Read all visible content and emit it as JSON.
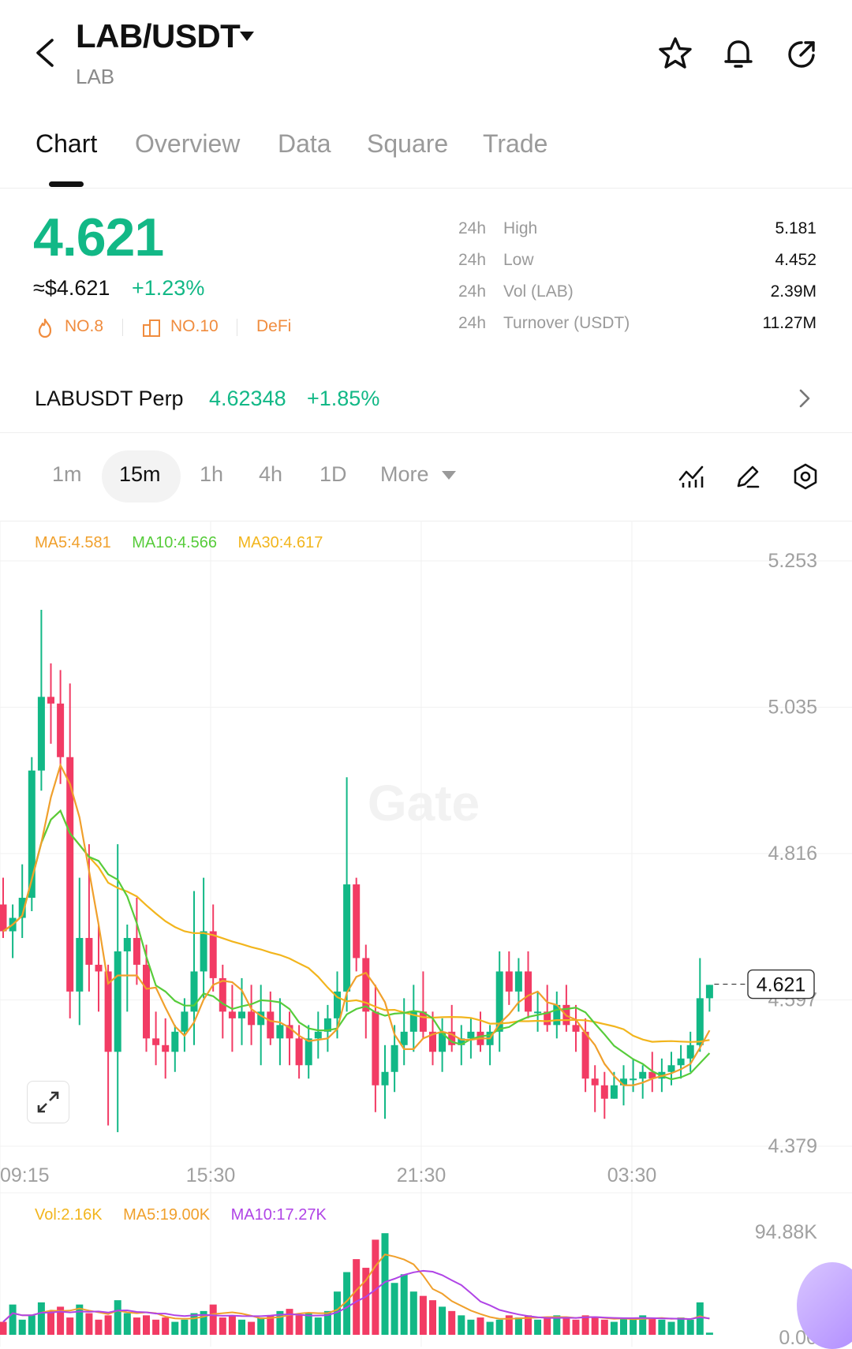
{
  "header": {
    "pair": "LAB/USDT",
    "base": "LAB",
    "icons": [
      "back-icon",
      "star-icon",
      "bell-icon",
      "share-icon"
    ]
  },
  "tabs": [
    {
      "label": "Chart",
      "active": true
    },
    {
      "label": "Overview"
    },
    {
      "label": "Data"
    },
    {
      "label": "Square"
    },
    {
      "label": "Trade"
    }
  ],
  "ticker": {
    "price": "4.621",
    "usd": "≈$4.621",
    "change": "+1.23%",
    "tags": [
      "NO.8",
      "NO.10",
      "DeFi"
    ],
    "stats": [
      {
        "prefix": "24h",
        "label": "High",
        "value": "5.181"
      },
      {
        "prefix": "24h",
        "label": "Low",
        "value": "4.452"
      },
      {
        "prefix": "24h",
        "label": "Vol (LAB)",
        "value": "2.39M"
      },
      {
        "prefix": "24h",
        "label": "Turnover (USDT)",
        "value": "11.27M"
      }
    ]
  },
  "perp": {
    "name": "LABUSDT Perp",
    "price": "4.62348",
    "change": "+1.85%"
  },
  "intervals": {
    "items": [
      "1m",
      "15m",
      "1h",
      "4h",
      "1D",
      "More"
    ],
    "active": "15m"
  },
  "colors": {
    "up": "#12b886",
    "down": "#f23b64",
    "ma5": "#f0a02c",
    "ma10": "#57cc3b",
    "ma30": "#f2b51d",
    "vol_ma10": "#b044e6"
  },
  "chart_data": {
    "type": "candlestick",
    "interval": "15m",
    "ma_legend": [
      {
        "label": "MA5:4.581"
      },
      {
        "label": "MA10:4.566"
      },
      {
        "label": "MA30:4.617"
      }
    ],
    "y_ticks": [
      "5.253",
      "5.035",
      "4.816",
      "4.597",
      "4.379"
    ],
    "ylim": [
      4.379,
      5.253
    ],
    "x_ticks": [
      "09:15",
      "15:30",
      "21:30",
      "03:30"
    ],
    "high_marker": "5.181",
    "low_marker": "4.452",
    "last_price": "4.621",
    "candles_ohlc": [
      [
        4.74,
        4.78,
        4.69,
        4.7
      ],
      [
        4.7,
        4.74,
        4.66,
        4.72
      ],
      [
        4.72,
        4.8,
        4.69,
        4.75
      ],
      [
        4.75,
        4.96,
        4.73,
        4.94
      ],
      [
        4.94,
        5.18,
        4.91,
        5.05
      ],
      [
        5.05,
        5.1,
        4.98,
        5.04
      ],
      [
        5.04,
        5.09,
        4.92,
        4.96
      ],
      [
        4.96,
        5.07,
        4.57,
        4.61
      ],
      [
        4.61,
        4.78,
        4.56,
        4.69
      ],
      [
        4.69,
        4.83,
        4.61,
        4.65
      ],
      [
        4.65,
        4.71,
        4.58,
        4.64
      ],
      [
        4.64,
        4.65,
        4.41,
        4.52
      ],
      [
        4.52,
        4.83,
        4.4,
        4.67
      ],
      [
        4.67,
        4.71,
        4.58,
        4.69
      ],
      [
        4.69,
        4.75,
        4.62,
        4.65
      ],
      [
        4.65,
        4.68,
        4.52,
        4.54
      ],
      [
        4.54,
        4.58,
        4.5,
        4.53
      ],
      [
        4.53,
        4.57,
        4.48,
        4.52
      ],
      [
        4.52,
        4.56,
        4.49,
        4.55
      ],
      [
        4.55,
        4.6,
        4.52,
        4.58
      ],
      [
        4.58,
        4.76,
        4.53,
        4.64
      ],
      [
        4.64,
        4.78,
        4.6,
        4.7
      ],
      [
        4.7,
        4.74,
        4.61,
        4.63
      ],
      [
        4.63,
        4.65,
        4.54,
        4.58
      ],
      [
        4.58,
        4.62,
        4.52,
        4.57
      ],
      [
        4.57,
        4.63,
        4.53,
        4.58
      ],
      [
        4.58,
        4.62,
        4.53,
        4.56
      ],
      [
        4.56,
        4.62,
        4.5,
        4.58
      ],
      [
        4.58,
        4.61,
        4.53,
        4.54
      ],
      [
        4.54,
        4.6,
        4.5,
        4.56
      ],
      [
        4.56,
        4.58,
        4.5,
        4.54
      ],
      [
        4.54,
        4.56,
        4.48,
        4.5
      ],
      [
        4.5,
        4.56,
        4.48,
        4.54
      ],
      [
        4.54,
        4.58,
        4.51,
        4.55
      ],
      [
        4.55,
        4.59,
        4.52,
        4.57
      ],
      [
        4.57,
        4.64,
        4.54,
        4.61
      ],
      [
        4.61,
        4.93,
        4.58,
        4.77
      ],
      [
        4.77,
        4.78,
        4.64,
        4.66
      ],
      [
        4.66,
        4.68,
        4.54,
        4.58
      ],
      [
        4.58,
        4.62,
        4.43,
        4.47
      ],
      [
        4.47,
        4.53,
        4.42,
        4.49
      ],
      [
        4.49,
        4.56,
        4.46,
        4.53
      ],
      [
        4.53,
        4.6,
        4.5,
        4.55
      ],
      [
        4.55,
        4.62,
        4.52,
        4.58
      ],
      [
        4.58,
        4.64,
        4.54,
        4.55
      ],
      [
        4.55,
        4.58,
        4.5,
        4.52
      ],
      [
        4.52,
        4.57,
        4.49,
        4.55
      ],
      [
        4.55,
        4.59,
        4.52,
        4.53
      ],
      [
        4.53,
        4.56,
        4.5,
        4.54
      ],
      [
        4.54,
        4.57,
        4.51,
        4.55
      ],
      [
        4.55,
        4.58,
        4.52,
        4.53
      ],
      [
        4.53,
        4.56,
        4.5,
        4.55
      ],
      [
        4.55,
        4.67,
        4.52,
        4.64
      ],
      [
        4.64,
        4.67,
        4.59,
        4.61
      ],
      [
        4.61,
        4.66,
        4.58,
        4.64
      ],
      [
        4.64,
        4.67,
        4.57,
        4.58
      ],
      [
        4.58,
        4.61,
        4.55,
        4.58
      ],
      [
        4.58,
        4.62,
        4.55,
        4.56
      ],
      [
        4.56,
        4.61,
        4.54,
        4.59
      ],
      [
        4.59,
        4.62,
        4.55,
        4.56
      ],
      [
        4.56,
        4.59,
        4.52,
        4.55
      ],
      [
        4.55,
        4.57,
        4.46,
        4.48
      ],
      [
        4.48,
        4.5,
        4.43,
        4.47
      ],
      [
        4.47,
        4.49,
        4.42,
        4.45
      ],
      [
        4.45,
        4.49,
        4.45,
        4.47
      ],
      [
        4.47,
        4.5,
        4.44,
        4.48
      ],
      [
        4.48,
        4.51,
        4.46,
        4.48
      ],
      [
        4.48,
        4.5,
        4.45,
        4.49
      ],
      [
        4.49,
        4.52,
        4.46,
        4.48
      ],
      [
        4.48,
        4.51,
        4.46,
        4.49
      ],
      [
        4.49,
        4.52,
        4.47,
        4.5
      ],
      [
        4.5,
        4.53,
        4.48,
        4.51
      ],
      [
        4.51,
        4.55,
        4.49,
        4.53
      ],
      [
        4.53,
        4.66,
        4.52,
        4.6
      ],
      [
        4.6,
        4.62,
        4.58,
        4.62
      ]
    ]
  },
  "volume": {
    "legend": [
      {
        "label": "Vol:2.16K"
      },
      {
        "label": "MA5:19.00K"
      },
      {
        "label": "MA10:17.27K"
      }
    ],
    "y_ticks": [
      "94.88K",
      "0.00"
    ],
    "ylim_k": [
      0,
      94.88
    ],
    "bars_k": [
      12,
      28,
      14,
      18,
      30,
      22,
      26,
      16,
      28,
      20,
      14,
      18,
      32,
      20,
      16,
      18,
      14,
      16,
      12,
      14,
      20,
      22,
      28,
      16,
      18,
      14,
      12,
      16,
      18,
      22,
      24,
      18,
      20,
      16,
      22,
      40,
      58,
      70,
      62,
      88,
      94,
      48,
      56,
      40,
      36,
      32,
      26,
      22,
      18,
      14,
      16,
      12,
      14,
      18,
      16,
      18,
      14,
      16,
      18,
      16,
      14,
      18,
      16,
      14,
      12,
      16,
      14,
      18,
      16,
      14,
      12,
      16,
      14,
      30,
      2
    ]
  },
  "watermark": "Gate"
}
